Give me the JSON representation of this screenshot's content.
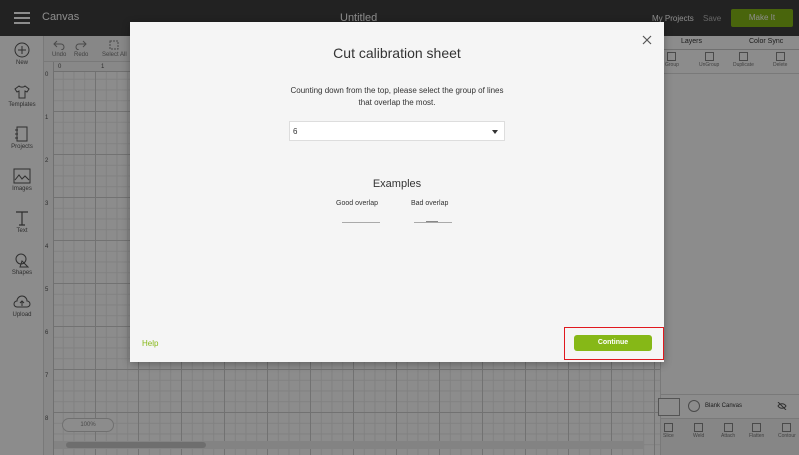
{
  "topbar": {
    "app_title": "Canvas",
    "doc_title": "Untitled",
    "my_projects": "My Projects",
    "save": "Save",
    "make_it": "Make It"
  },
  "left_tools": [
    {
      "label": "New",
      "icon": "plus-circle-icon"
    },
    {
      "label": "Templates",
      "icon": "tshirt-icon"
    },
    {
      "label": "Projects",
      "icon": "notebook-icon"
    },
    {
      "label": "Images",
      "icon": "image-icon"
    },
    {
      "label": "Text",
      "icon": "text-icon"
    },
    {
      "label": "Shapes",
      "icon": "shapes-icon"
    },
    {
      "label": "Upload",
      "icon": "cloud-upload-icon"
    }
  ],
  "edit_toolbar": {
    "undo": "Undo",
    "redo": "Redo",
    "select_all": "Select All"
  },
  "rulers": {
    "top": [
      "0",
      "1"
    ],
    "left": [
      "0",
      "1",
      "2",
      "3",
      "4",
      "5",
      "6",
      "7",
      "8"
    ]
  },
  "zoom": "100%",
  "right_panel": {
    "tabs": [
      "Layers",
      "Color Sync"
    ],
    "actions": [
      "Group",
      "UnGroup",
      "Duplicate",
      "Delete"
    ],
    "blank_canvas": "Blank Canvas",
    "bottom_actions": [
      "Slice",
      "Weld",
      "Attach",
      "Flatten",
      "Contour"
    ]
  },
  "dialog": {
    "title": "Cut calibration sheet",
    "instruction": "Counting down from the top, please select the group of lines that overlap the most.",
    "select_value": "6",
    "examples_heading": "Examples",
    "good_overlap": "Good overlap",
    "bad_overlap": "Bad overlap",
    "help": "Help",
    "continue": "Continue"
  },
  "colors": {
    "accent_green": "#86b817",
    "highlight_red": "#e0181e",
    "topbar": "#3f3f3f"
  }
}
